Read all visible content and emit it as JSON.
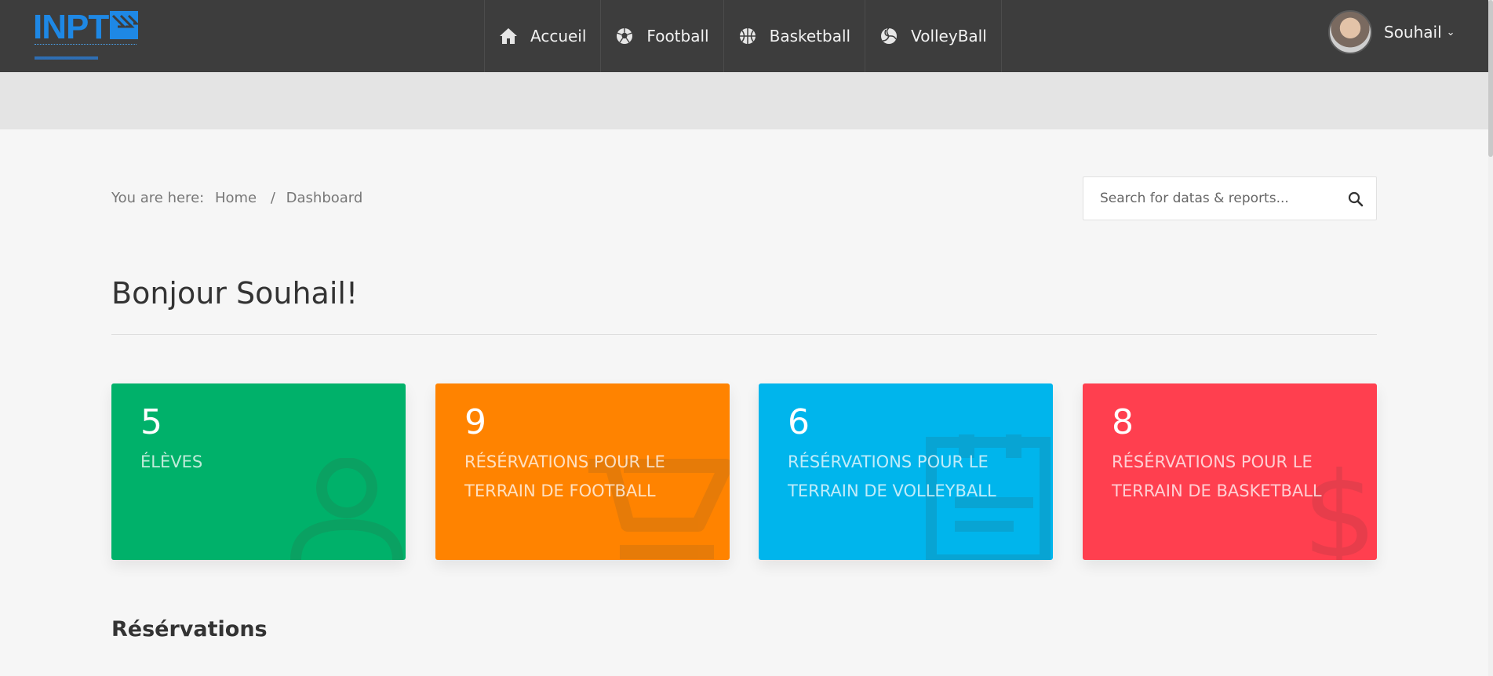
{
  "brand": {
    "logo_text": "INPT"
  },
  "nav": [
    {
      "label": "Accueil",
      "icon": "home-icon"
    },
    {
      "label": "Football",
      "icon": "football-icon"
    },
    {
      "label": "Basketball",
      "icon": "basketball-icon"
    },
    {
      "label": "VolleyBall",
      "icon": "volleyball-icon"
    }
  ],
  "user": {
    "name": "Souhail",
    "caret": "⌄"
  },
  "breadcrumb": {
    "prefix": "You are here:",
    "home": "Home",
    "separator": "/",
    "current": "Dashboard"
  },
  "search": {
    "placeholder": "Search for datas & reports..."
  },
  "greeting": "Bonjour Souhail!",
  "stats": [
    {
      "value": "5",
      "label": "ÉLÈVES",
      "color": "#00b16a",
      "icon": "user-icon"
    },
    {
      "value": "9",
      "label": "RÉSÉRVATIONS POUR LE TERRAIN DE FOOTBALL",
      "color": "#ff8300",
      "icon": "cart-icon"
    },
    {
      "value": "6",
      "label": "RÉSÉRVATIONS POUR LE TERRAIN DE VOLLEYBALL",
      "color": "#00b5ec",
      "icon": "document-icon"
    },
    {
      "value": "8",
      "label": "RÉSÉRVATIONS POUR LE TERRAIN DE BASKETBALL",
      "color": "#ff3f4f",
      "icon": "dollar-icon"
    }
  ],
  "sections": {
    "reservations_title": "Résérvations"
  }
}
